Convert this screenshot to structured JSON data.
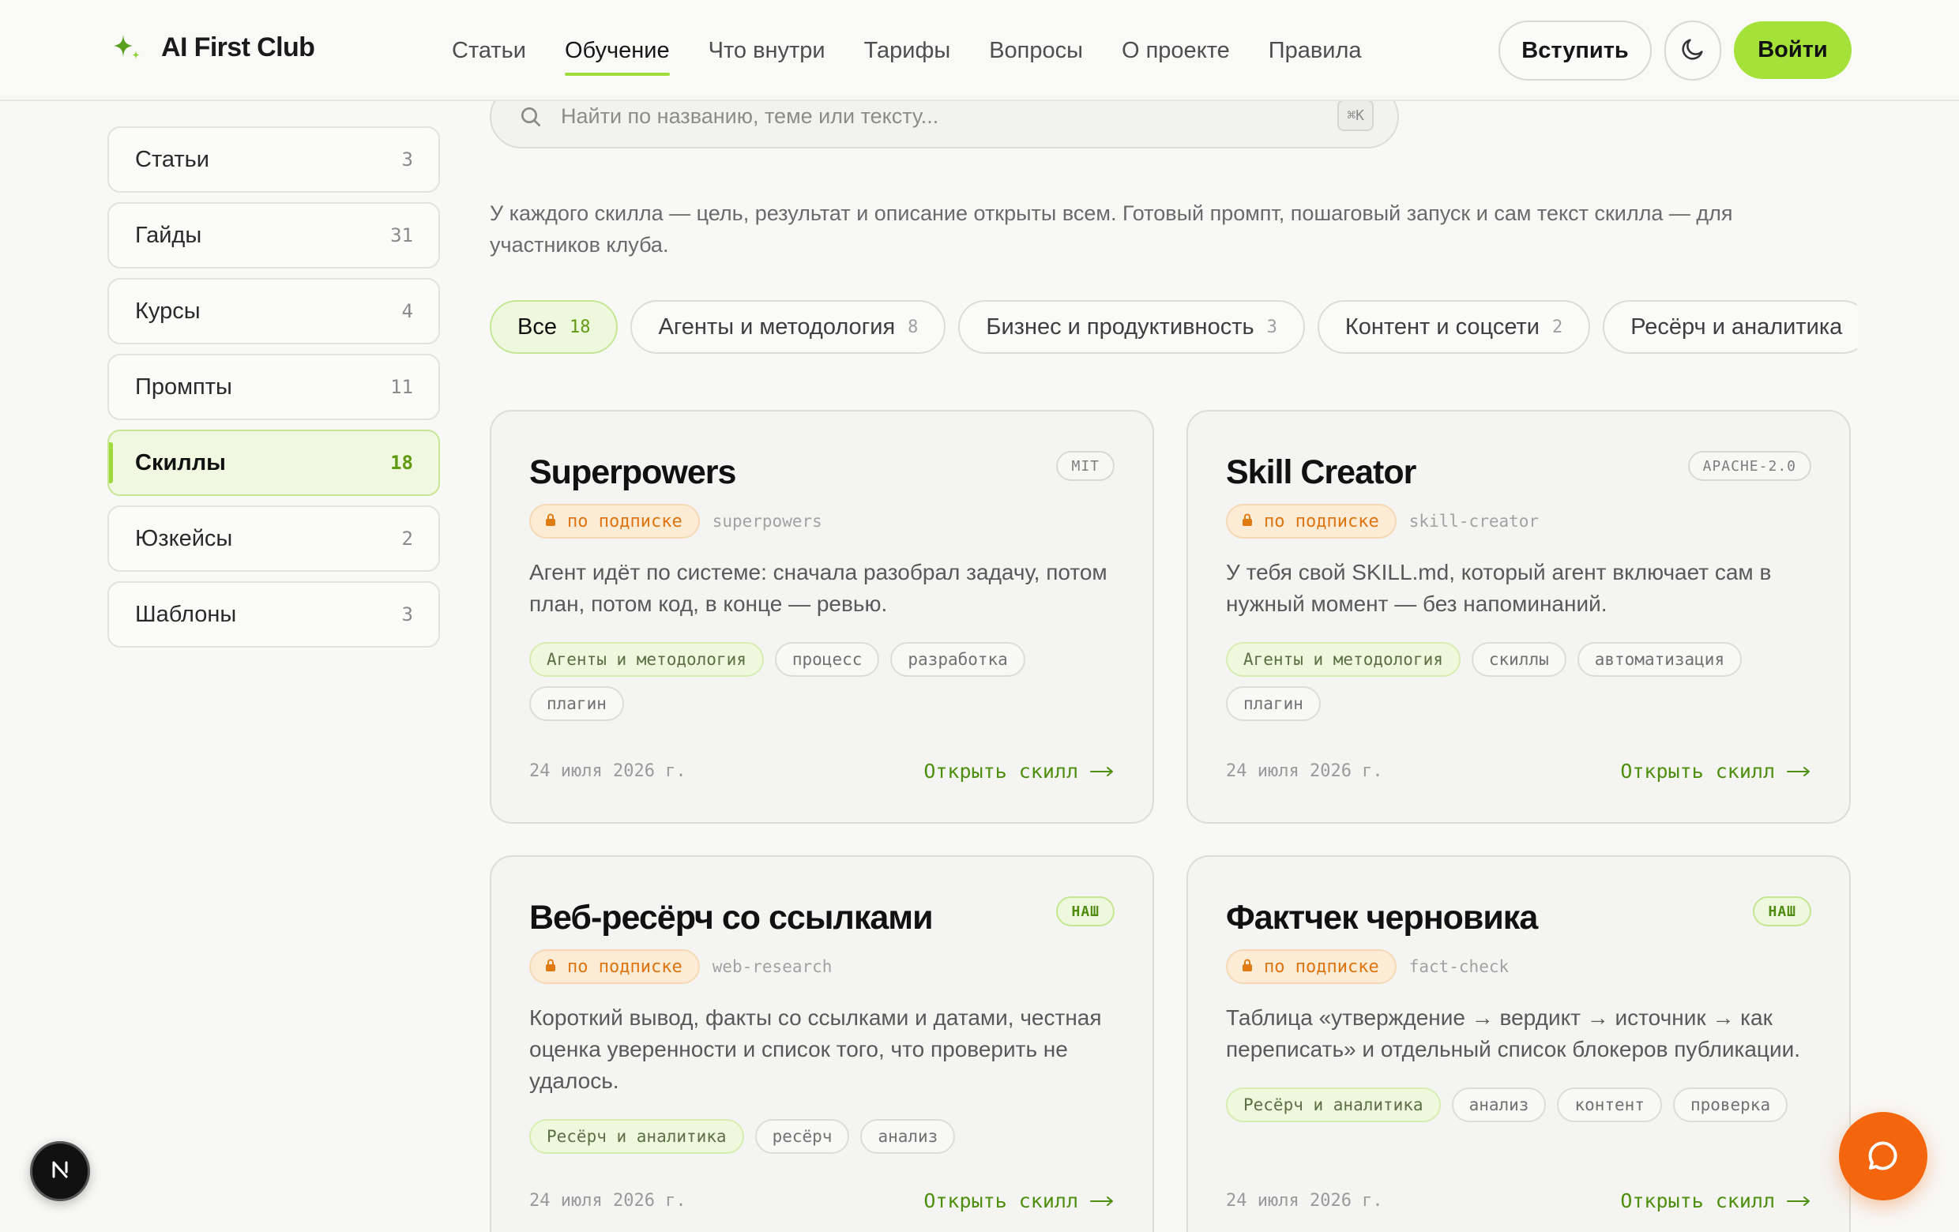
{
  "header": {
    "brand": "AI First Club",
    "nav": [
      {
        "label": "Статьи",
        "active": false
      },
      {
        "label": "Обучение",
        "active": true
      },
      {
        "label": "Что внутри",
        "active": false
      },
      {
        "label": "Тарифы",
        "active": false
      },
      {
        "label": "Вопросы",
        "active": false
      },
      {
        "label": "О проекте",
        "active": false
      },
      {
        "label": "Правила",
        "active": false
      }
    ],
    "join_label": "Вступить",
    "login_label": "Войти"
  },
  "sidebar": {
    "items": [
      {
        "label": "Статьи",
        "count": "3",
        "active": false
      },
      {
        "label": "Гайды",
        "count": "31",
        "active": false
      },
      {
        "label": "Курсы",
        "count": "4",
        "active": false
      },
      {
        "label": "Промпты",
        "count": "11",
        "active": false
      },
      {
        "label": "Скиллы",
        "count": "18",
        "active": true
      },
      {
        "label": "Юзкейсы",
        "count": "2",
        "active": false
      },
      {
        "label": "Шаблоны",
        "count": "3",
        "active": false
      }
    ]
  },
  "search": {
    "placeholder": "Найти по названию, теме или тексту...",
    "shortcut": "⌘K"
  },
  "intro": "У каждого скилла — цель, результат и описание открыты всем. Готовый промпт, пошаговый запуск и сам текст скилла — для участников клуба.",
  "filters": [
    {
      "label": "Все",
      "count": "18",
      "active": true
    },
    {
      "label": "Агенты и методология",
      "count": "8",
      "active": false
    },
    {
      "label": "Бизнес и продуктивность",
      "count": "3",
      "active": false
    },
    {
      "label": "Контент и соцсети",
      "count": "2",
      "active": false
    },
    {
      "label": "Ресёрч и аналитика",
      "count": "",
      "active": false
    }
  ],
  "cards": [
    {
      "title": "Superpowers",
      "license": "MIT",
      "ours": false,
      "access": "по подписке",
      "slug": "superpowers",
      "description": "Агент идёт по системе: сначала разобрал задачу, потом план, потом код, в конце — ревью.",
      "tags": [
        "Агенты и методология",
        "процесс",
        "разработка",
        "плагин"
      ],
      "date": "24 июля 2026 г.",
      "link": "Открыть скилл"
    },
    {
      "title": "Skill Creator",
      "license": "APACHE-2.0",
      "ours": false,
      "access": "по подписке",
      "slug": "skill-creator",
      "description": "У тебя свой SKILL.md, который агент включает сам в нужный момент — без напоминаний.",
      "tags": [
        "Агенты и методология",
        "скиллы",
        "автоматизация",
        "плагин"
      ],
      "date": "24 июля 2026 г.",
      "link": "Открыть скилл"
    },
    {
      "title": "Веб-ресёрч со ссылками",
      "license": "НАШ",
      "ours": true,
      "access": "по подписке",
      "slug": "web-research",
      "description": "Короткий вывод, факты со ссылками и датами, честная оценка уверенности и список того, что проверить не удалось.",
      "tags": [
        "Ресёрч и аналитика",
        "ресёрч",
        "анализ"
      ],
      "date": "24 июля 2026 г.",
      "link": "Открыть скилл"
    },
    {
      "title": "Фактчек черновика",
      "license": "НАШ",
      "ours": true,
      "access": "по подписке",
      "slug": "fact-check",
      "description": "Таблица «утверждение → вердикт → источник → как переписать» и отдельный список блокеров публикации.",
      "tags": [
        "Ресёрч и аналитика",
        "анализ",
        "контент",
        "проверка"
      ],
      "date": "24 июля 2026 г.",
      "link": "Открыть скилл"
    }
  ],
  "colors": {
    "accent": "#a4e23a",
    "accent_text": "#4f8f10",
    "subscription": "#dd7410",
    "chat_fab": "#f4660e"
  },
  "icons": [
    "sparkle-icon",
    "moon-icon",
    "search-icon",
    "lock-icon",
    "arrow-right-icon",
    "chat-bubble-icon",
    "next-logo-icon"
  ]
}
